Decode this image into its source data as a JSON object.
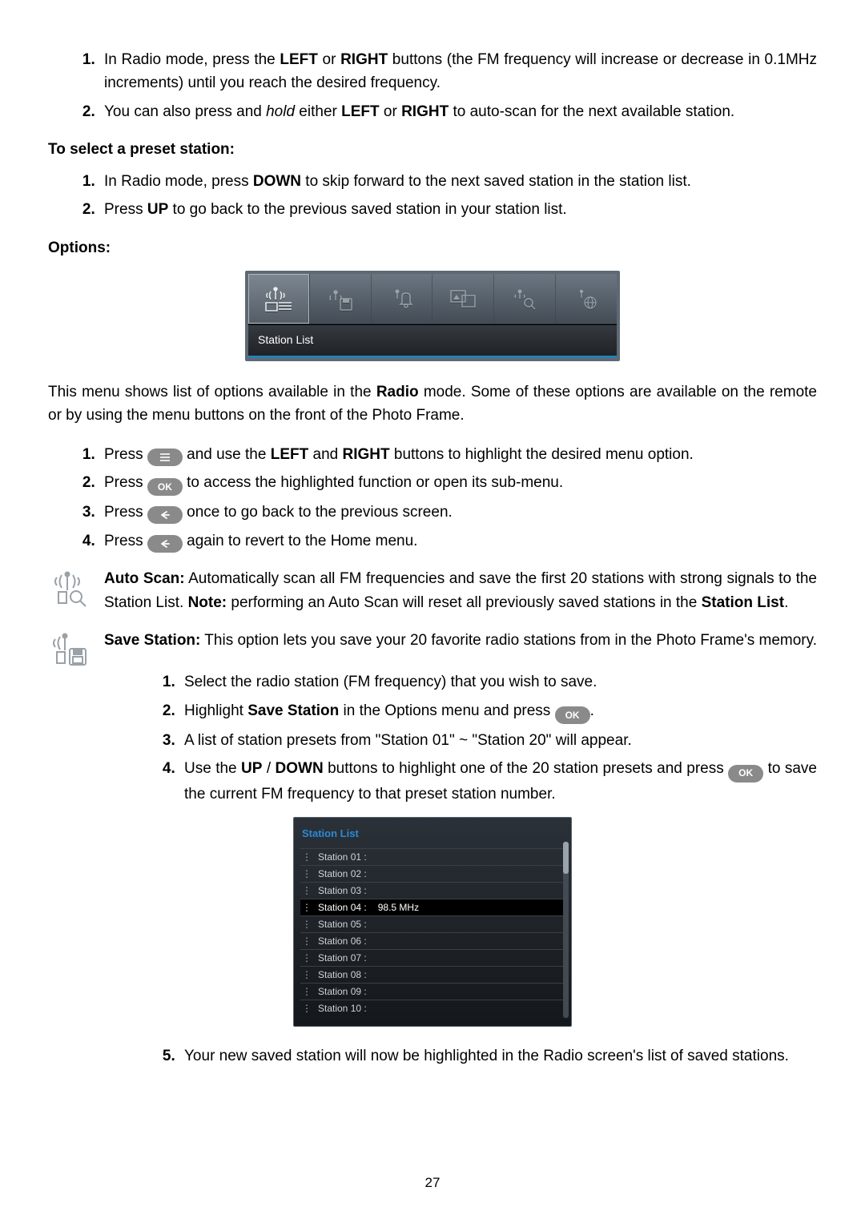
{
  "top_list": {
    "i1_a": "In Radio mode, press the ",
    "i1_b": "LEFT",
    "i1_c": " or ",
    "i1_d": "RIGHT",
    "i1_e": " buttons (the FM frequency will increase or decrease in 0.1MHz increments) until you reach the desired frequency.",
    "i2_a": "You can also press and ",
    "i2_b": "hold",
    "i2_c": " either ",
    "i2_d": "LEFT",
    "i2_e": " or ",
    "i2_f": "RIGHT",
    "i2_g": " to auto-scan for the next available station."
  },
  "preset_heading": "To select a preset station:",
  "preset_list": {
    "i1_a": "In Radio mode, press ",
    "i1_b": "DOWN",
    "i1_c": " to skip forward to the next saved station in the station list.",
    "i2_a": "Press ",
    "i2_b": "UP",
    "i2_c": " to go back to the previous saved station in your station list."
  },
  "options_heading": "Options:",
  "options_strip_label": "Station List",
  "options_intro_a": "This menu shows list of options available in the ",
  "options_intro_b": "Radio",
  "options_intro_c": " mode. Some of these options are available on the remote or by using the menu buttons on the front of the Photo Frame.",
  "options_steps": {
    "i1_a": "Press ",
    "i1_b": " and use the ",
    "i1_c": "LEFT",
    "i1_d": " and ",
    "i1_e": "RIGHT",
    "i1_f": " buttons to highlight the desired menu option.",
    "i2_a": "Press ",
    "i2_b": " to access the highlighted function or open its sub-menu.",
    "i3_a": "Press ",
    "i3_b": " once to go back to the previous screen.",
    "i4_a": "Press ",
    "i4_b": " again to revert to the Home menu."
  },
  "ok_label": "OK",
  "auto_scan": {
    "title": "Auto Scan:",
    "body_a": " Automatically scan all FM frequencies and save the first 20 stations with strong signals to the Station List. ",
    "note_label": "Note:",
    "body_b": " performing an Auto Scan will reset all previously saved stations in the ",
    "body_c": "Station List",
    "body_d": "."
  },
  "save_station": {
    "title": "Save Station:",
    "body": " This option lets you save your 20 favorite radio stations from in the Photo Frame's memory."
  },
  "save_steps": {
    "i1": "Select the radio station (FM frequency) that you wish to save.",
    "i2_a": "Highlight ",
    "i2_b": "Save Station",
    "i2_c": " in the Options menu and press ",
    "i2_d": ".",
    "i3": "A list of station presets from \"Station 01\" ~ \"Station 20\" will appear.",
    "i4_a": "Use the ",
    "i4_b": "UP",
    "i4_c": " / ",
    "i4_d": "DOWN",
    "i4_e": " buttons to highlight one of the 20 station presets and press ",
    "i4_f": " to save the current FM frequency to that preset station number.",
    "i5": "Your new saved station will now be highlighted in the Radio screen's list of saved stations."
  },
  "station_panel": {
    "title": "Station List",
    "rows": [
      {
        "label": "Station 01 :",
        "value": ""
      },
      {
        "label": "Station 02 :",
        "value": ""
      },
      {
        "label": "Station 03 :",
        "value": ""
      },
      {
        "label": "Station 04 :",
        "value": "98.5 MHz"
      },
      {
        "label": "Station 05 :",
        "value": ""
      },
      {
        "label": "Station 06 :",
        "value": ""
      },
      {
        "label": "Station 07 :",
        "value": ""
      },
      {
        "label": "Station 08 :",
        "value": ""
      },
      {
        "label": "Station 09 :",
        "value": ""
      },
      {
        "label": "Station 10 :",
        "value": ""
      }
    ],
    "selected_index": 3
  },
  "page_number": "27"
}
